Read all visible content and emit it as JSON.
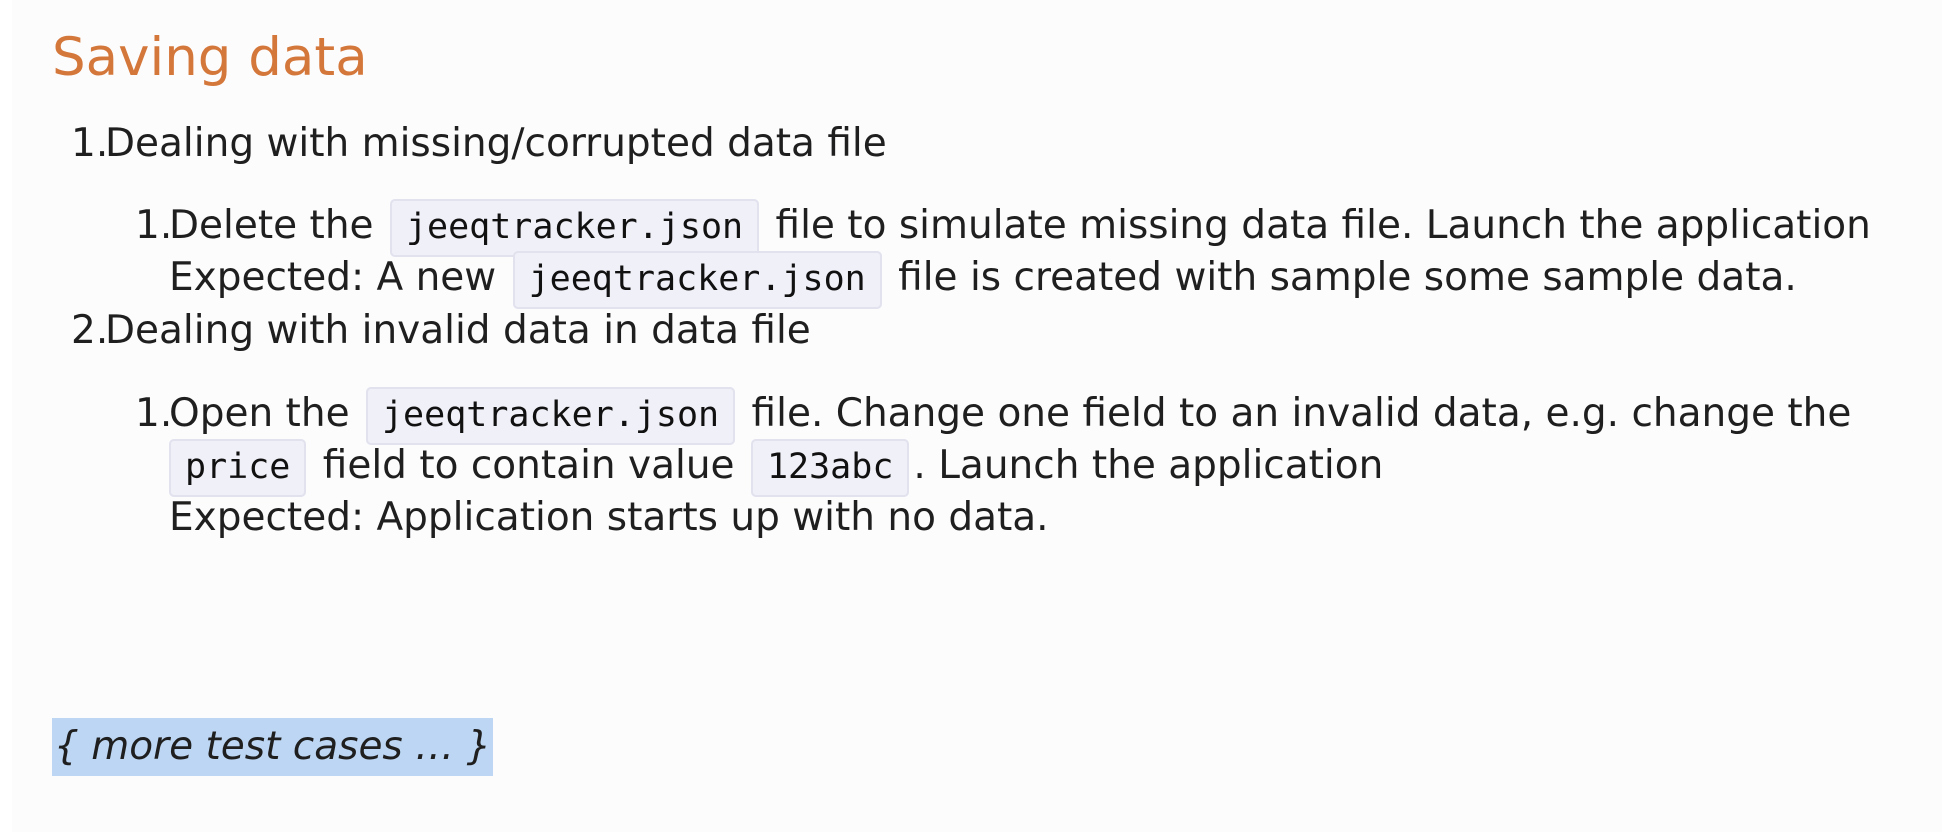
{
  "section": {
    "title": "Saving data"
  },
  "items": [
    {
      "number": "1.",
      "label": "Dealing with missing/corrupted data file",
      "sub": [
        {
          "number": "1.",
          "line1": {
            "t1": "Delete the",
            "code1": "jeeqtracker.json",
            "t2": "file to simulate missing data file. Launch the application"
          },
          "line2": {
            "t1": "Expected: A new",
            "code1": "jeeqtracker.json",
            "t2": "file is created with sample some sample data."
          }
        }
      ]
    },
    {
      "number": "2.",
      "label": "Dealing with invalid data in data file",
      "sub": [
        {
          "number": "1.",
          "line1": {
            "t1": "Open the",
            "code1": "jeeqtracker.json",
            "t2": "file. Change one field to an invalid data, e.g. change the"
          },
          "line2": {
            "code1": "price",
            "t1": "field to contain value",
            "code2": "123abc",
            "t2": ". Launch the application"
          },
          "line3": {
            "t1": "Expected: Application starts up with no data."
          }
        }
      ]
    }
  ],
  "footer": {
    "more": "{ more test cases … }"
  }
}
